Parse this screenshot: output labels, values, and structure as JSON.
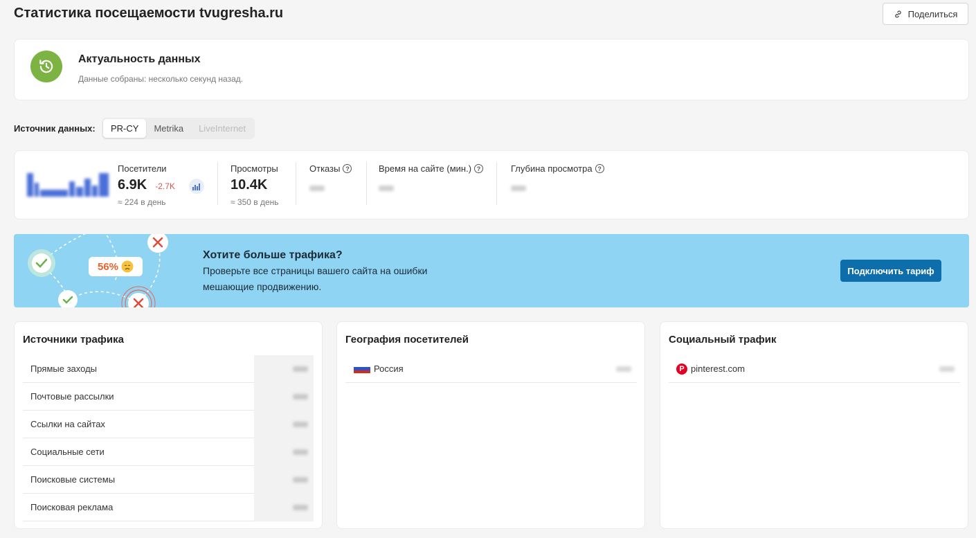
{
  "header": {
    "title": "Статистика посещаемости tvugresha.ru",
    "share_label": "Поделиться"
  },
  "freshness": {
    "title": "Актуальность данных",
    "text": "Данные собраны: несколько секунд назад."
  },
  "source": {
    "label": "Источник данных:",
    "tabs": [
      {
        "label": "PR-CY",
        "state": "active"
      },
      {
        "label": "Metrika",
        "state": "normal"
      },
      {
        "label": "LiveInternet",
        "state": "disabled"
      }
    ]
  },
  "stats": {
    "visitors": {
      "label": "Посетители",
      "value": "6.9K",
      "delta": "-2.7K",
      "sub": "≈ 224 в день"
    },
    "views": {
      "label": "Просмотры",
      "value": "10.4K",
      "sub": "≈ 350 в день"
    },
    "bounce": {
      "label": "Отказы"
    },
    "time": {
      "label": "Время на сайте (мин.)"
    },
    "depth": {
      "label": "Глубина просмотра"
    }
  },
  "promo": {
    "badge": "56%",
    "title": "Хотите больше трафика?",
    "text": "Проверьте все страницы вашего сайта на ошибки мешающие продвижению.",
    "button": "Подключить тариф"
  },
  "traffic_sources": {
    "title": "Источники трафика",
    "items": [
      {
        "label": "Прямые заходы"
      },
      {
        "label": "Почтовые рассылки"
      },
      {
        "label": "Ссылки на сайтах"
      },
      {
        "label": "Социальные сети"
      },
      {
        "label": "Поисковые системы"
      },
      {
        "label": "Поисковая реклама"
      }
    ]
  },
  "geography": {
    "title": "География посетителей",
    "items": [
      {
        "label": "Россия",
        "flag_colors": [
          "#ffffff",
          "#2a55c9",
          "#d52b1e"
        ]
      }
    ]
  },
  "social": {
    "title": "Социальный трафик",
    "items": [
      {
        "label": "pinterest.com",
        "icon": "pinterest-icon"
      }
    ]
  },
  "colors": {
    "accent_green": "#7cb342",
    "promo_bg": "#8fd4f2",
    "promo_button": "#0d6eab",
    "delta_red": "#d9534f"
  }
}
